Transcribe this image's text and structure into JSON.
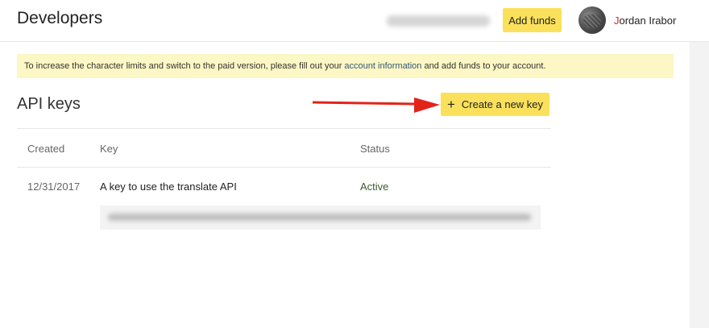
{
  "header": {
    "title": "Developers",
    "add_funds_label": "Add funds",
    "user_first_initial": "J",
    "user_name_rest": "ordan Irabor"
  },
  "notice": {
    "text_before": "To increase the character limits and switch to the paid version, please fill out your ",
    "link_text": "account information",
    "text_after": " and add funds to your account."
  },
  "api_keys": {
    "title": "API keys",
    "create_label": "Create a new key",
    "create_icon": "plus-icon",
    "columns": [
      "Created",
      "Key",
      "Status"
    ],
    "rows": [
      {
        "created": "12/31/2017",
        "key": "A key to use the translate API",
        "status": "Active"
      }
    ]
  },
  "colors": {
    "accent_yellow": "#fbe15b",
    "notice_bg": "#fcf7c4",
    "arrow_red": "#e2231a",
    "link": "#33587a"
  }
}
